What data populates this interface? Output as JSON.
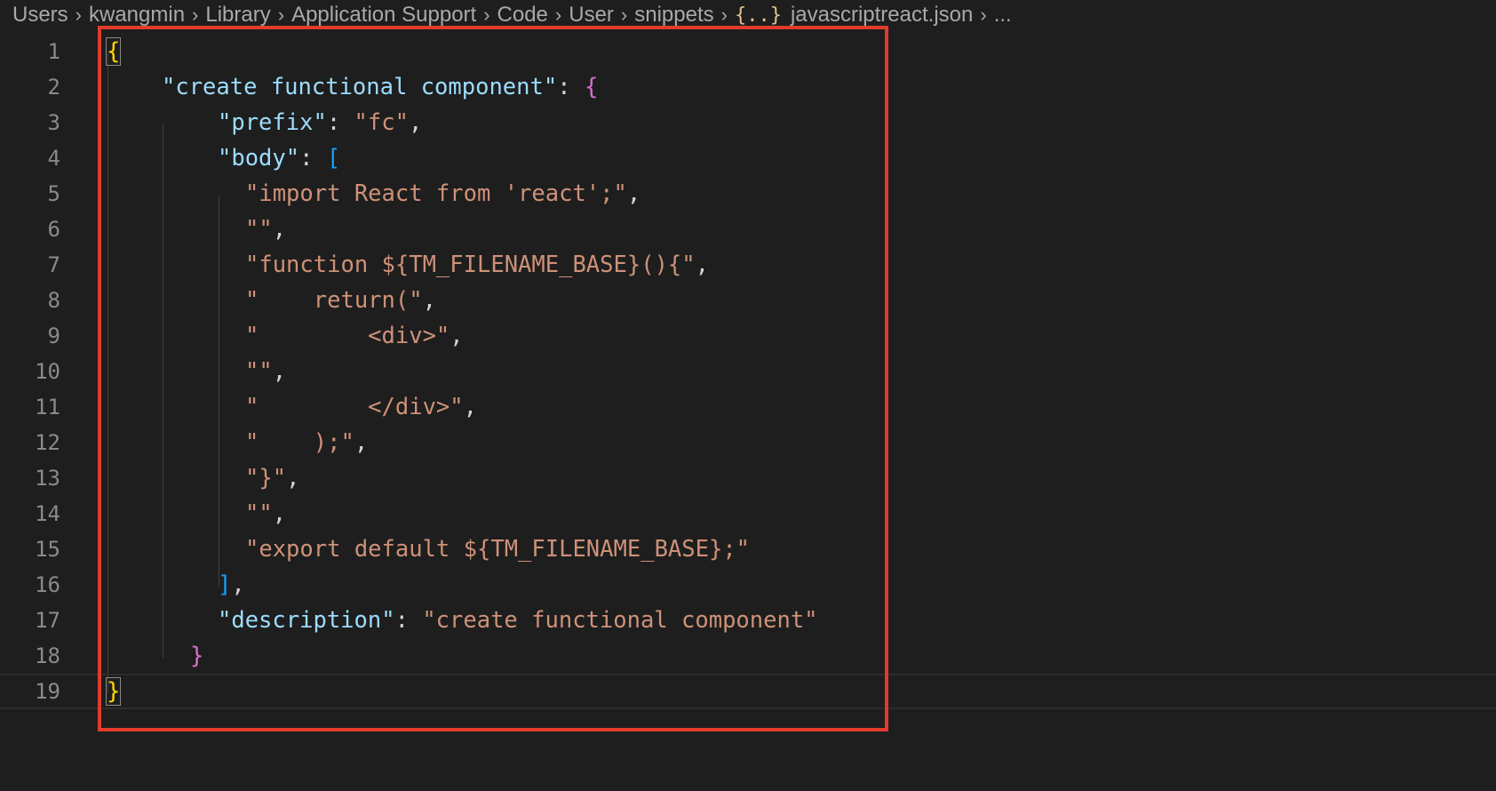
{
  "breadcrumb": {
    "items": [
      "Users",
      "kwangmin",
      "Library",
      "Application Support",
      "Code",
      "User",
      "snippets"
    ],
    "file_icon": "{..}",
    "file_name": "javascriptreact.json",
    "overflow": "..."
  },
  "editor": {
    "line_numbers": [
      "1",
      "2",
      "3",
      "4",
      "5",
      "6",
      "7",
      "8",
      "9",
      "10",
      "11",
      "12",
      "13",
      "14",
      "15",
      "16",
      "17",
      "18",
      "19"
    ],
    "lines": {
      "l1": {
        "brace": "{"
      },
      "l2": {
        "key": "\"create functional component\"",
        "colon": ": ",
        "brace": "{"
      },
      "l3": {
        "key": "\"prefix\"",
        "colon": ": ",
        "value": "\"fc\"",
        "comma": ","
      },
      "l4": {
        "key": "\"body\"",
        "colon": ": ",
        "bracket": "["
      },
      "l5": {
        "value": "\"import React from 'react';\"",
        "comma": ","
      },
      "l6": {
        "value": "\"\"",
        "comma": ","
      },
      "l7": {
        "value": "\"function ${TM_FILENAME_BASE}(){\"",
        "comma": ","
      },
      "l8": {
        "value": "\"    return(\"",
        "comma": ","
      },
      "l9": {
        "value": "\"        <div>\"",
        "comma": ","
      },
      "l10": {
        "value": "\"\"",
        "comma": ","
      },
      "l11": {
        "value": "\"        </div>\"",
        "comma": ","
      },
      "l12": {
        "value": "\"    );\"",
        "comma": ","
      },
      "l13": {
        "value": "\"}\"",
        "comma": ","
      },
      "l14": {
        "value": "\"\"",
        "comma": ","
      },
      "l15": {
        "value": "\"export default ${TM_FILENAME_BASE};\""
      },
      "l16": {
        "bracket": "]",
        "comma": ","
      },
      "l17": {
        "key": "\"description\"",
        "colon": ": ",
        "value": "\"create functional component\""
      },
      "l18": {
        "brace": "}"
      },
      "l19": {
        "brace": "}"
      }
    }
  },
  "colors": {
    "background": "#1e1e1e",
    "key": "#9cdcfe",
    "string": "#ce9178",
    "bracket_level1": "#ffd700",
    "bracket_level2": "#da70d6",
    "bracket_level3": "#179fff",
    "highlight_border": "#e23b2b"
  }
}
